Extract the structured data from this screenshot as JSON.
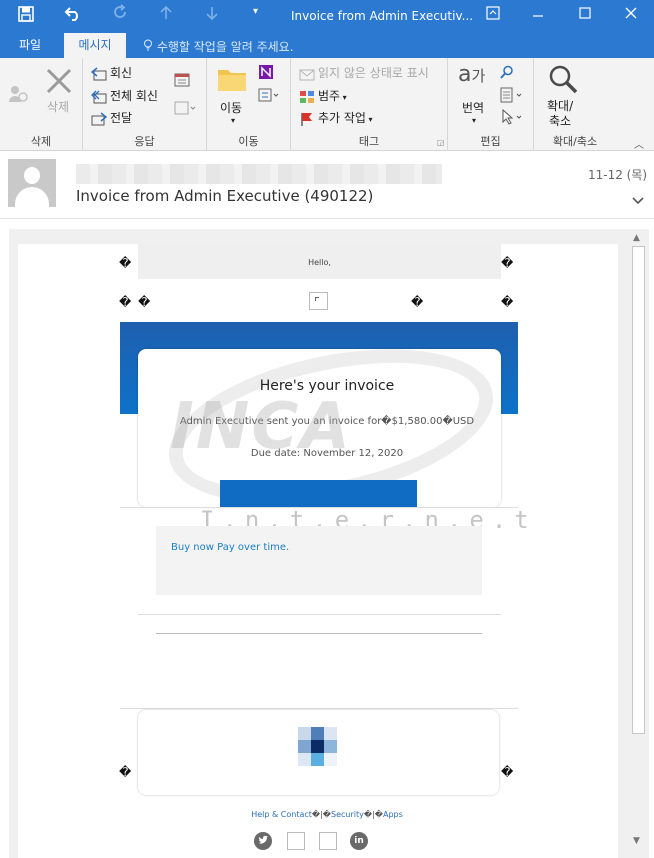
{
  "window": {
    "title": "Invoice from Admin Executiv...",
    "qat": {
      "save_icon": "save-icon",
      "undo_icon": "undo-icon",
      "redo_icon": "redo-icon"
    }
  },
  "tabs": {
    "file": "파일",
    "message": "메시지",
    "tell_me": "수행할 작업을 알려 주세요."
  },
  "ribbon": {
    "delete_group": {
      "label": "삭제",
      "delete": "삭제"
    },
    "respond_group": {
      "label": "응답",
      "reply": "회신",
      "reply_all": "전체 회신",
      "forward": "전달"
    },
    "move_group": {
      "label": "이동",
      "move": "이동"
    },
    "tags_group": {
      "label": "태그",
      "unread": "읽지 않은 상태로 표시",
      "categorize": "범주",
      "followup": "추가 작업"
    },
    "edit_group": {
      "label": "편집",
      "translate": "번역"
    },
    "zoom_group": {
      "label": "확대/축소",
      "zoom_line1": "확대/",
      "zoom_line2": "축소"
    }
  },
  "message_header": {
    "subject": "Invoice from Admin Executive (490122)",
    "date": "11-12 (목)"
  },
  "email": {
    "hello": "Hello,",
    "invoice_title": "Here's your invoice",
    "sent_line": "Admin Executive sent you an invoice for�$1,580.00�USD",
    "due_date": "Due date: November 12, 2020",
    "watermark": "INCA",
    "watermark_sub": "I.n.t.e.r.n.e.t",
    "promo_link": "Buy now Pay over time.",
    "footer_links": {
      "help": "Help & Contact",
      "sep": "�|�",
      "security": "Security",
      "apps": "Apps"
    },
    "placeholder_glyph": "�"
  },
  "colors": {
    "accent": "#2b79d0",
    "banner": "#1565c0",
    "link": "#1a7fc0"
  }
}
